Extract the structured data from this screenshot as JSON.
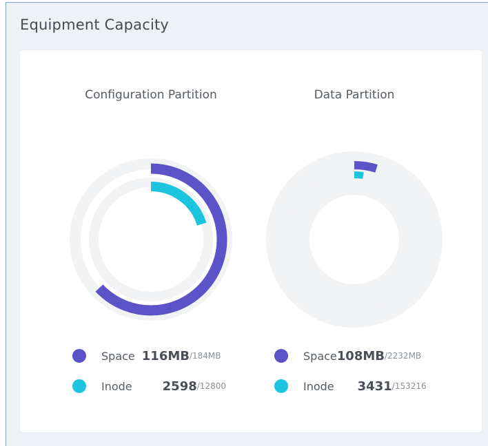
{
  "panel": {
    "title": "Equipment Capacity"
  },
  "colors": {
    "space": "#5b53c8",
    "inode": "#1dc4df",
    "track": "#f2f3f5"
  },
  "partitions": [
    {
      "title": "Configuration Partition",
      "space": {
        "label": "Space",
        "used": "116MB",
        "total": "/184MB",
        "fraction": 0.63
      },
      "inode": {
        "label": "Inode",
        "used": "2598",
        "total": "/12800",
        "fraction": 0.203
      }
    },
    {
      "title": "Data Partition",
      "space": {
        "label": "Space",
        "used": "108MB",
        "total": "/2232MB",
        "fraction": 0.048
      },
      "inode": {
        "label": "Inode",
        "used": "3431",
        "total": "/153216",
        "fraction": 0.022
      }
    }
  ]
}
